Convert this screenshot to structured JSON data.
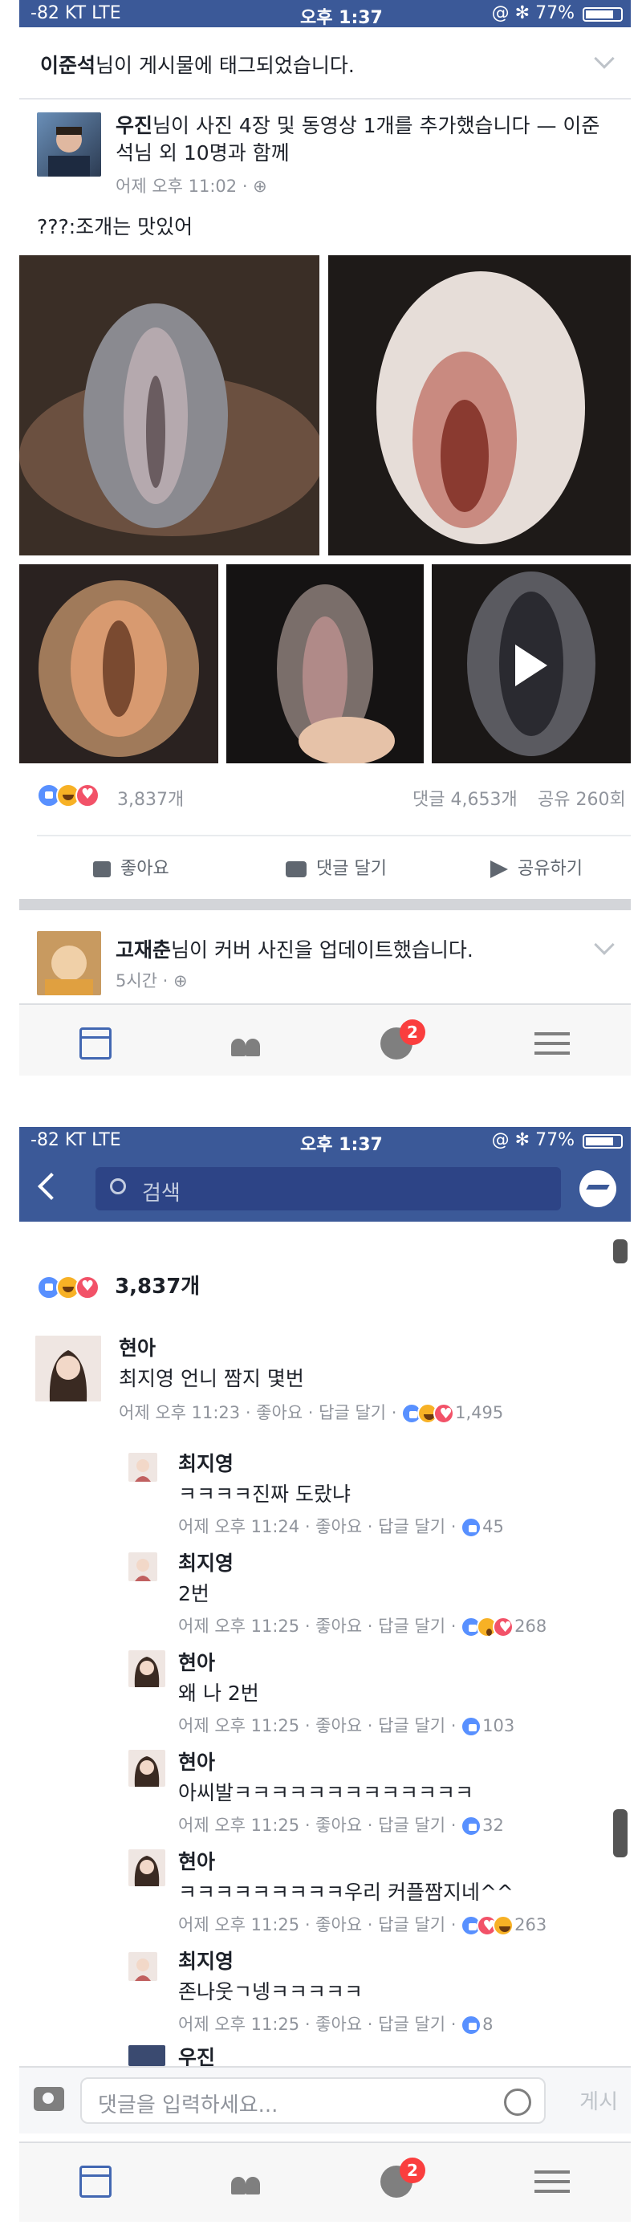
{
  "status": {
    "carrier": "-82 KT  LTE",
    "time": "오후 1:37",
    "battery": "@ ✻ 77%"
  },
  "tag_notice": {
    "name": "이준석",
    "text": "님이 게시물에 태그되었습니다."
  },
  "post": {
    "author": "우진",
    "headline": "님이 사진 4장 및 동영상 1개를 추가했습니다 — 이준석님 외 10명과 함께",
    "meta": "어제 오후 11:02 · ⊕",
    "caption": "???:조개는 맛있어",
    "reaction_count": "3,837개",
    "comments": "댓글 4,653개",
    "shares": "공유 260회",
    "actions": {
      "like": "좋아요",
      "comment": "댓글 달기",
      "share": "공유하기"
    }
  },
  "next_post": {
    "author": "고재춘",
    "text": "님이 커버 사진을 업데이트했습니다.",
    "meta": "5시간 · ⊕"
  },
  "tabbar": {
    "badge": "2"
  },
  "search": {
    "placeholder": "검색"
  },
  "reactions_header": "3,837개",
  "comments": [
    {
      "name": "현아",
      "text": "최지영 언니 짬지 몇번",
      "meta": "어제 오후 11:23 · 좋아요 · 답글 달기 ·",
      "count": "1,495"
    },
    {
      "name": "최지영",
      "text": "ㅋㅋㅋㅋ진짜 도랐냐",
      "meta": "어제 오후 11:24 · 좋아요 · 답글 달기 ·",
      "count": "45"
    },
    {
      "name": "최지영",
      "text": "2번",
      "meta": "어제 오후 11:25 · 좋아요 · 답글 달기 ·",
      "count": "268"
    },
    {
      "name": "현아",
      "text": "왜 나 2번",
      "meta": "어제 오후 11:25 · 좋아요 · 답글 달기 ·",
      "count": "103"
    },
    {
      "name": "현아",
      "text": "아씨발ㅋㅋㅋㅋㅋㅋㅋㅋㅋㅋㅋㅋㅋ",
      "meta": "어제 오후 11:25 · 좋아요 · 답글 달기 ·",
      "count": "32"
    },
    {
      "name": "현아",
      "text": "ㅋㅋㅋㅋㅋㅋㅋㅋㅋ우리 커플짬지네^^",
      "meta": "어제 오후 11:25 · 좋아요 · 답글 달기 ·",
      "count": "263"
    },
    {
      "name": "최지영",
      "text": "존나웃ㄱ넹ㅋㅋㅋㅋㅋ",
      "meta": "어제 오후 11:25 · 좋아요 · 답글 달기 ·",
      "count": "8"
    },
    {
      "name": "우진",
      "text": "",
      "meta": "",
      "count": ""
    }
  ],
  "composer": {
    "placeholder": "댓글을 입력하세요...",
    "post_label": "게시"
  },
  "colors": {
    "fb_blue": "#3b5998",
    "like": "#5890ff",
    "love": "#f25268",
    "haha": "#f7b125",
    "badge": "#fa3e3e"
  }
}
